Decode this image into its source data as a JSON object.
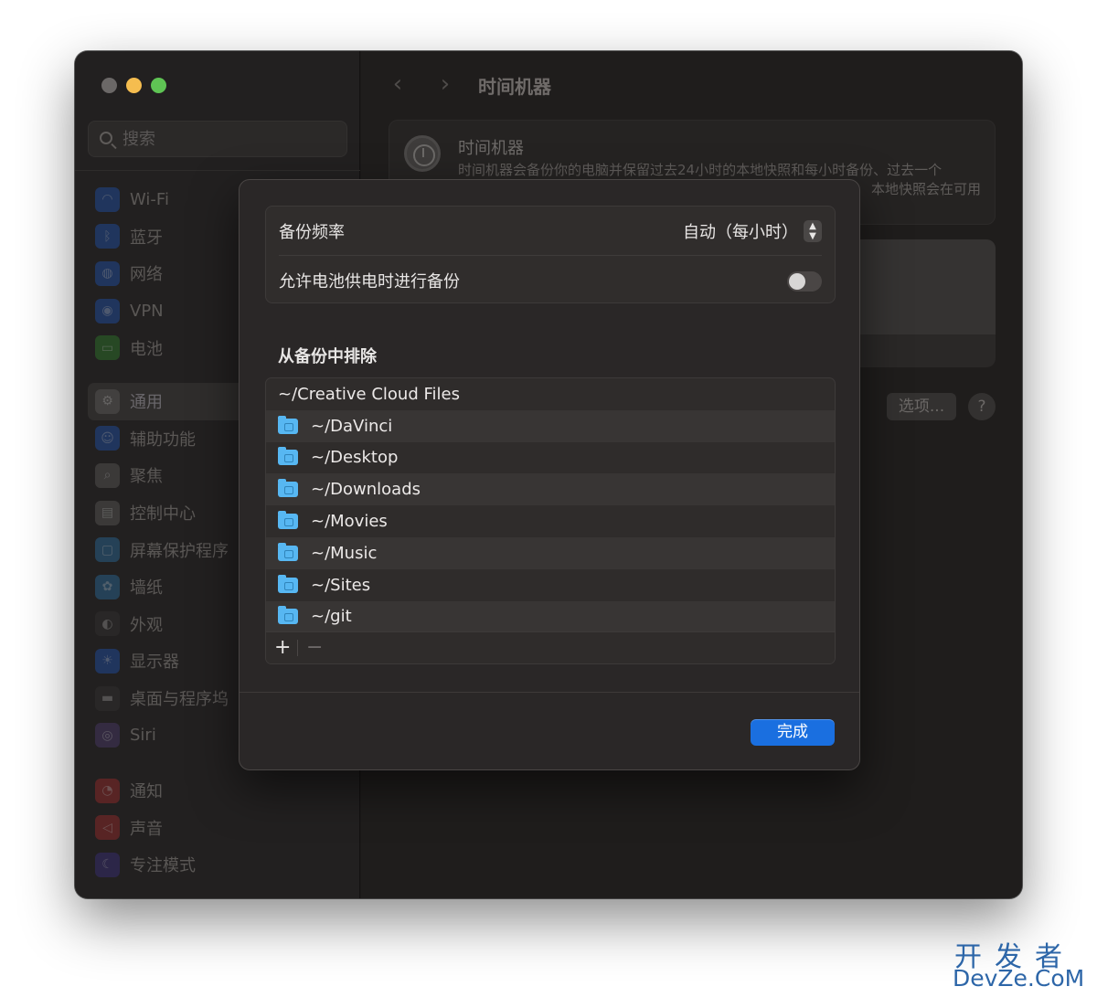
{
  "window": {
    "search_placeholder": "搜索",
    "breadcrumb_title": "时间机器"
  },
  "sidebar": {
    "items": [
      {
        "label": "Wi-Fi",
        "icon": "wifi-icon",
        "color": "#1f4fa8",
        "active": false
      },
      {
        "label": "蓝牙",
        "icon": "bluetooth-icon",
        "color": "#1f4fa8",
        "active": false
      },
      {
        "label": "网络",
        "icon": "globe-icon",
        "color": "#1f4fa8",
        "active": false
      },
      {
        "label": "VPN",
        "icon": "vpn-icon",
        "color": "#1f4fa8",
        "active": false
      },
      {
        "label": "电池",
        "icon": "battery-icon",
        "color": "#2f7a2a",
        "active": false
      },
      {
        "label": "通用",
        "icon": "gear-icon",
        "color": "#5a5857",
        "active": true
      },
      {
        "label": "辅助功能",
        "icon": "accessibility-icon",
        "color": "#1f4fa8",
        "active": false
      },
      {
        "label": "聚焦",
        "icon": "spotlight-icon",
        "color": "#5a5857",
        "active": false
      },
      {
        "label": "控制中心",
        "icon": "control-center-icon",
        "color": "#5a5857",
        "active": false
      },
      {
        "label": "屏幕保护程序",
        "icon": "screensaver-icon",
        "color": "#2a6a9a",
        "active": false
      },
      {
        "label": "墙纸",
        "icon": "wallpaper-icon",
        "color": "#2a6a9a",
        "active": false
      },
      {
        "label": "外观",
        "icon": "appearance-icon",
        "color": "#333130",
        "active": false
      },
      {
        "label": "显示器",
        "icon": "display-icon",
        "color": "#1f4fa8",
        "active": false
      },
      {
        "label": "桌面与程序坞",
        "icon": "dock-icon",
        "color": "#333130",
        "active": false
      },
      {
        "label": "Siri",
        "icon": "siri-icon",
        "color": "#4a3a6a",
        "active": false
      },
      {
        "label": "通知",
        "icon": "notifications-icon",
        "color": "#9a2a2a",
        "active": false
      },
      {
        "label": "声音",
        "icon": "sound-icon",
        "color": "#9a2a2a",
        "active": false
      },
      {
        "label": "专注模式",
        "icon": "focus-icon",
        "color": "#3a2f7a",
        "active": false
      }
    ]
  },
  "main": {
    "card_title": "时间机器",
    "card_desc_line1": "时间机器会备份你的电脑并保留过去24小时的本地快照和每小时备份、过去一个",
    "card_desc_line2": "本地快照会在可用",
    "options_label": "选项...",
    "help_label": "?"
  },
  "sheet": {
    "backup_frequency_label": "备份频率",
    "backup_frequency_value": "自动（每小时）",
    "battery_backup_label": "允许电池供电时进行备份",
    "battery_backup_enabled": false,
    "exclude_title": "从备份中排除",
    "exclude_items": [
      {
        "path": "~/Creative Cloud Files",
        "icon": null
      },
      {
        "path": "~/DaVinci",
        "icon": "folder-icon"
      },
      {
        "path": "~/Desktop",
        "icon": "folder-icon"
      },
      {
        "path": "~/Downloads",
        "icon": "folder-icon"
      },
      {
        "path": "~/Movies",
        "icon": "folder-icon"
      },
      {
        "path": "~/Music",
        "icon": "folder-icon"
      },
      {
        "path": "~/Sites",
        "icon": "folder-icon"
      },
      {
        "path": "~/git",
        "icon": "folder-icon"
      }
    ],
    "add_label": "+",
    "remove_label": "−",
    "done_label": "完成",
    "accent_color": "#1a6fe0",
    "folder_color": "#57b7f2"
  },
  "watermark": {
    "top": "开发者",
    "bottom": "DevZe.CoM"
  }
}
